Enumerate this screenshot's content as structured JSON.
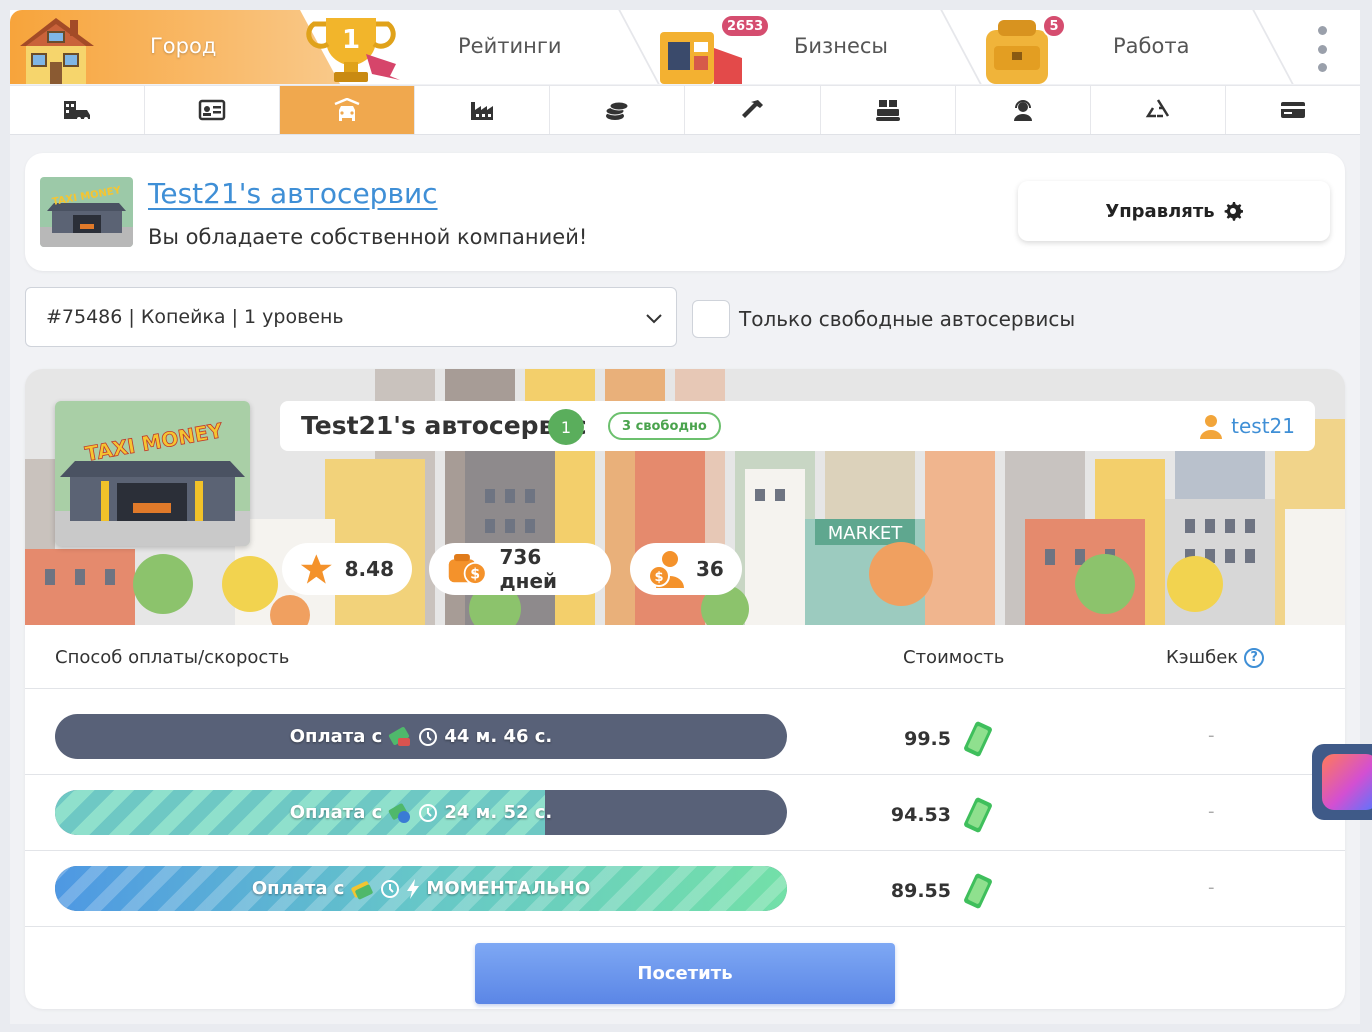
{
  "top_tabs": {
    "city": "Город",
    "ratings": "Рейтинги",
    "ratings_badge": "1",
    "business": "Бизнесы",
    "business_badge": "2653",
    "work": "Работа",
    "work_badge": "5"
  },
  "sub_tabs": [
    {
      "icon": "car-dealer-icon"
    },
    {
      "icon": "id-card-icon"
    },
    {
      "icon": "car-service-icon",
      "active": true
    },
    {
      "icon": "factory-icon"
    },
    {
      "icon": "coins-icon"
    },
    {
      "icon": "hammer-icon"
    },
    {
      "icon": "conveyor-icon"
    },
    {
      "icon": "support-agent-icon"
    },
    {
      "icon": "recycle-icon"
    },
    {
      "icon": "credit-card-icon"
    }
  ],
  "owner": {
    "title": "Test21's автосервис",
    "subtitle": "Вы обладаете собственной компанией!",
    "manage_label": "Управлять"
  },
  "filter": {
    "selected": "#75486 | Копейка | 1 уровень",
    "checkbox_label": "Только свободные автосервисы"
  },
  "service": {
    "name": "Test21's автосервис",
    "level": "1",
    "free_label": "3 свободно",
    "owner_name": "test21",
    "banner_thumb_text": "TAXI MONEY",
    "banner_market_text": "MARKET",
    "rating": "8.48",
    "days": "736 дней",
    "clients": "36"
  },
  "table": {
    "col_method": "Способ оплаты/скорость",
    "col_cost": "Стоимость",
    "col_cashback": "Кэшбек",
    "help": "?",
    "rows": [
      {
        "pay_label": "Оплата с",
        "time": "44 м. 46 с.",
        "progress": 0,
        "cost": "99.5",
        "cashback": "-"
      },
      {
        "pay_label": "Оплата с",
        "time": "24 м. 52 с.",
        "progress": 0.67,
        "cost": "94.53",
        "cashback": "-"
      },
      {
        "pay_label": "Оплата с",
        "time": "МОМЕНТАЛЬНО",
        "progress": 1,
        "cost": "89.55",
        "cashback": "-"
      }
    ],
    "visit_label": "Посетить"
  },
  "colors": {
    "accent_orange": "#f0a84e",
    "link_blue": "#3f8fd6",
    "bar_dark": "#586178",
    "button_blue": "#5b86e6",
    "level_green": "#5aae5c"
  }
}
